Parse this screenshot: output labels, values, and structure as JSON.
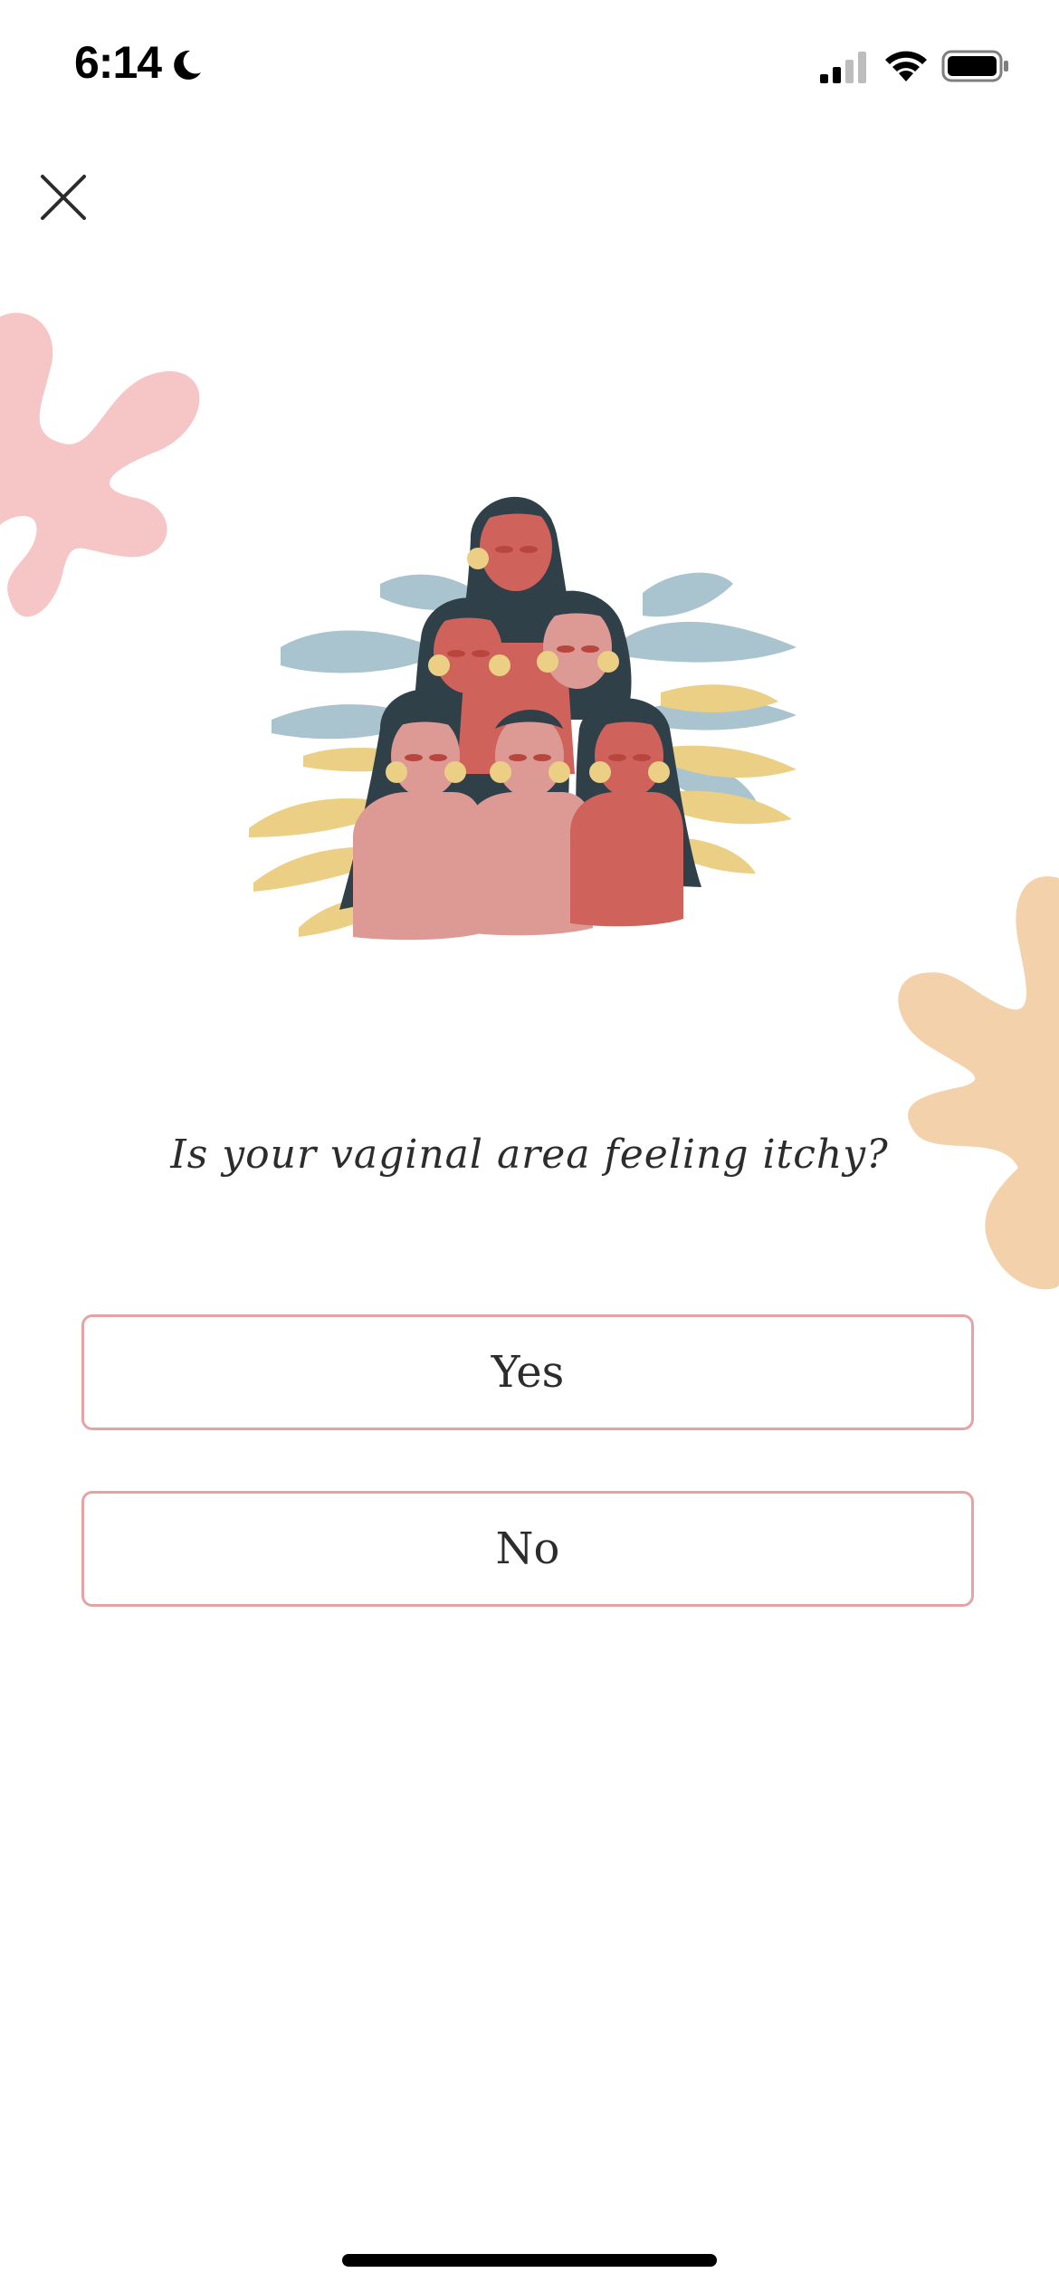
{
  "status_bar": {
    "time": "6:14",
    "icons": [
      "moon-icon",
      "signal-icon",
      "wifi-icon",
      "battery-icon"
    ]
  },
  "header": {
    "close_icon": "close-icon"
  },
  "content": {
    "illustration": "women-group-illustration",
    "question": "Is your vaginal area feeling itchy?",
    "options": [
      {
        "label": "Yes"
      },
      {
        "label": "No"
      }
    ]
  },
  "colors": {
    "button_border": "#e5a3a3",
    "blob_pink": "#f6c6c6",
    "blob_peach": "#f3d1aa",
    "hair": "#2f4048",
    "skin_dark": "#d0625c",
    "skin_light": "#dd9a94",
    "leaf_blue": "#a9c4cf",
    "leaf_yellow": "#ebcf85"
  }
}
